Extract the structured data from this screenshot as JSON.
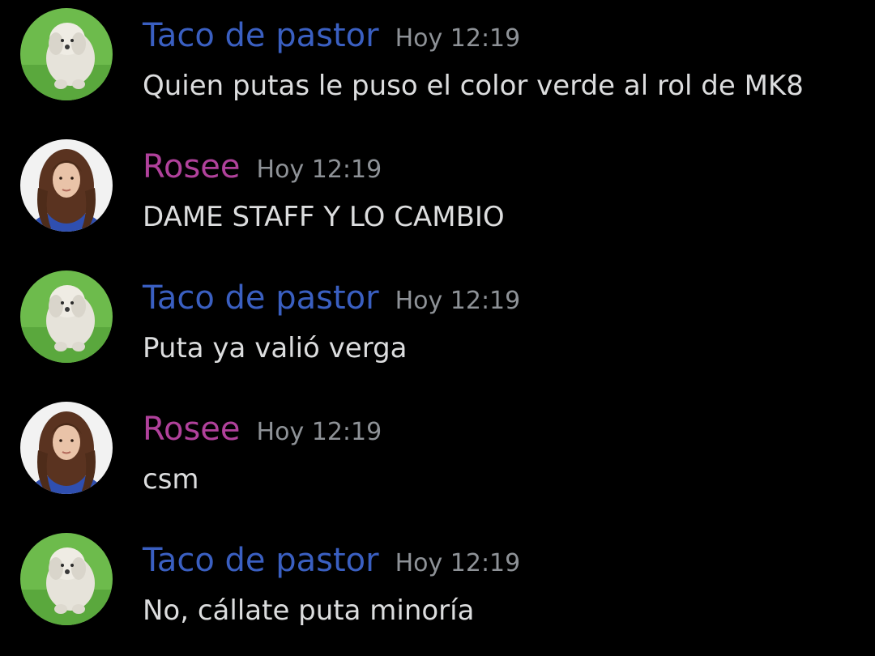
{
  "colors": {
    "background": "#000000",
    "message_text": "#dcddde",
    "timestamp": "#8e9297",
    "taco_role": "#3a5fc1",
    "rosee_role": "#b0419b"
  },
  "messages": [
    {
      "author": "Taco de pastor",
      "author_color": "#3a5fc1",
      "avatar": "dog-avatar",
      "timestamp": "Hoy 12:19",
      "text": "Quien putas le puso el color verde al rol de MK8"
    },
    {
      "author": "Rosee",
      "author_color": "#b0419b",
      "avatar": "girl-avatar",
      "timestamp": "Hoy 12:19",
      "text": "DAME STAFF Y LO CAMBIO"
    },
    {
      "author": "Taco de pastor",
      "author_color": "#3a5fc1",
      "avatar": "dog-avatar",
      "timestamp": "Hoy 12:19",
      "text": "Puta ya valió verga"
    },
    {
      "author": "Rosee",
      "author_color": "#b0419b",
      "avatar": "girl-avatar",
      "timestamp": "Hoy 12:19",
      "text": "csm"
    },
    {
      "author": "Taco de pastor",
      "author_color": "#3a5fc1",
      "avatar": "dog-avatar",
      "timestamp": "Hoy 12:19",
      "text": "No, cállate puta minoría"
    }
  ]
}
